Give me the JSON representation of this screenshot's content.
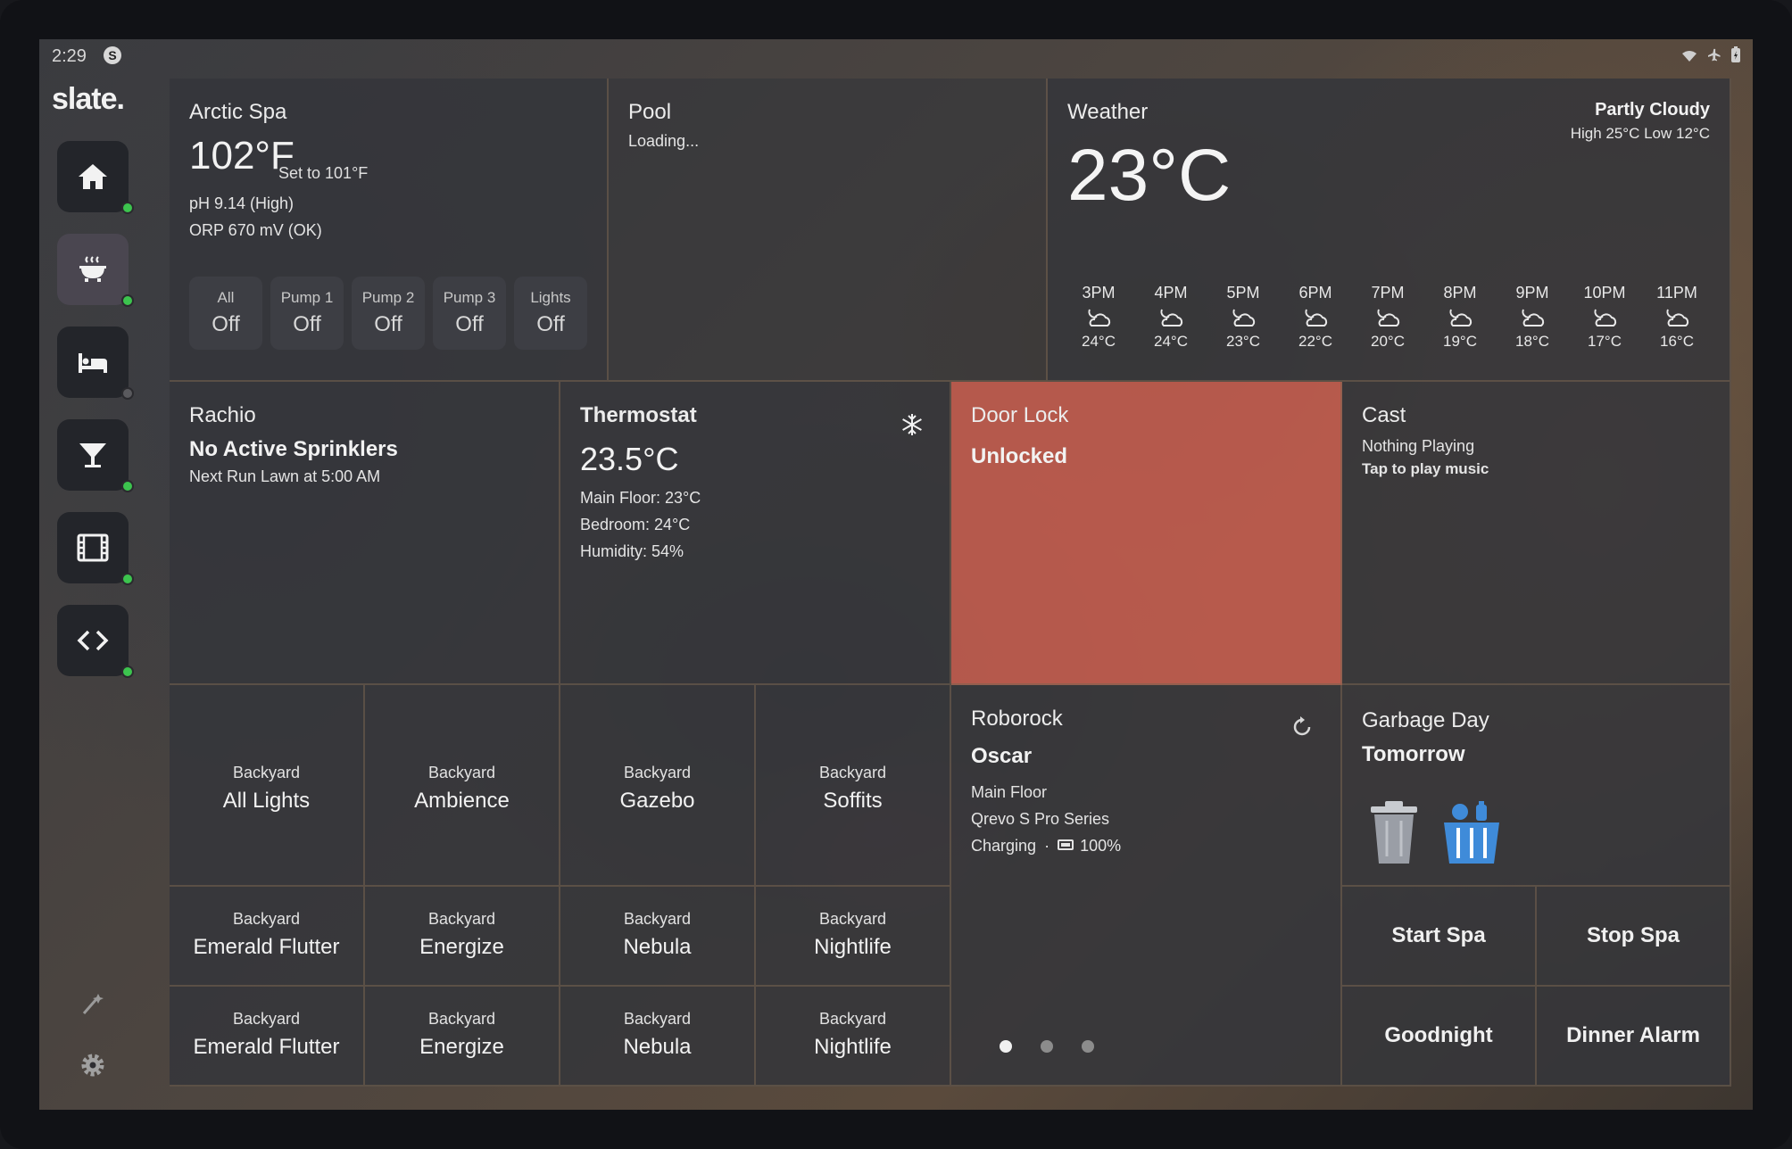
{
  "status": {
    "time": "2:29",
    "badge": "S"
  },
  "app": {
    "logo": "slate."
  },
  "nav": {
    "items": [
      {
        "icon": "home-icon",
        "active": false,
        "online": true
      },
      {
        "icon": "hot-tub-icon",
        "active": true,
        "online": true
      },
      {
        "icon": "bed-icon",
        "active": false,
        "online": false
      },
      {
        "icon": "cocktail-icon",
        "active": false,
        "online": true
      },
      {
        "icon": "film-icon",
        "active": false,
        "online": true
      },
      {
        "icon": "code-icon",
        "active": false,
        "online": true
      }
    ],
    "bottom": [
      "wand-icon",
      "gear-icon"
    ]
  },
  "spa": {
    "title": "Arctic Spa",
    "temp": "102°F",
    "setpoint": "Set to 101°F",
    "ph": "pH 9.14 (High)",
    "orp": "ORP 670 mV (OK)",
    "buttons": [
      {
        "label": "All",
        "value": "Off"
      },
      {
        "label": "Pump 1",
        "value": "Off"
      },
      {
        "label": "Pump 2",
        "value": "Off"
      },
      {
        "label": "Pump 3",
        "value": "Off"
      },
      {
        "label": "Lights",
        "value": "Off"
      }
    ]
  },
  "pool": {
    "title": "Pool",
    "status": "Loading..."
  },
  "weather": {
    "title": "Weather",
    "temp": "23°C",
    "condition": "Partly Cloudy",
    "highlow": "High 25°C  Low 12°C",
    "hourly": [
      {
        "hour": "3PM",
        "temp": "24°C",
        "icon": "partly-cloudy-night-icon"
      },
      {
        "hour": "4PM",
        "temp": "24°C",
        "icon": "partly-cloudy-night-icon"
      },
      {
        "hour": "5PM",
        "temp": "23°C",
        "icon": "partly-cloudy-night-icon"
      },
      {
        "hour": "6PM",
        "temp": "22°C",
        "icon": "partly-cloudy-night-icon"
      },
      {
        "hour": "7PM",
        "temp": "20°C",
        "icon": "partly-cloudy-night-icon"
      },
      {
        "hour": "8PM",
        "temp": "19°C",
        "icon": "partly-cloudy-night-icon"
      },
      {
        "hour": "9PM",
        "temp": "18°C",
        "icon": "partly-cloudy-night-icon"
      },
      {
        "hour": "10PM",
        "temp": "17°C",
        "icon": "partly-cloudy-night-icon"
      },
      {
        "hour": "11PM",
        "temp": "16°C",
        "icon": "partly-cloudy-night-icon"
      }
    ]
  },
  "rachio": {
    "title": "Rachio",
    "status": "No Active Sprinklers",
    "next": "Next Run Lawn at 5:00 AM"
  },
  "thermostat": {
    "title": "Thermostat",
    "temp": "23.5°C",
    "main": "Main Floor: 23°C",
    "bedroom": "Bedroom: 24°C",
    "humidity": "Humidity: 54%",
    "mode_icon": "snowflake-icon"
  },
  "doorlock": {
    "title": "Door Lock",
    "state": "Unlocked",
    "color": "#c45c4e"
  },
  "cast": {
    "title": "Cast",
    "status": "Nothing Playing",
    "hint": "Tap to play music"
  },
  "lights": {
    "row1": [
      {
        "room": "Backyard",
        "name": "All Lights"
      },
      {
        "room": "Backyard",
        "name": "Ambience"
      },
      {
        "room": "Backyard",
        "name": "Gazebo"
      },
      {
        "room": "Backyard",
        "name": "Soffits"
      }
    ],
    "row2": [
      {
        "room": "Backyard",
        "name": "Emerald Flutter"
      },
      {
        "room": "Backyard",
        "name": "Energize"
      },
      {
        "room": "Backyard",
        "name": "Nebula"
      },
      {
        "room": "Backyard",
        "name": "Nightlife"
      }
    ],
    "row3": [
      {
        "room": "Backyard",
        "name": "Emerald Flutter"
      },
      {
        "room": "Backyard",
        "name": "Energize"
      },
      {
        "room": "Backyard",
        "name": "Nebula"
      },
      {
        "room": "Backyard",
        "name": "Nightlife"
      }
    ]
  },
  "roborock": {
    "title": "Roborock",
    "name": "Oscar",
    "floor": "Main Floor",
    "model": "Qrevo S Pro Series",
    "state": "Charging",
    "separator": "·",
    "battery": "100%"
  },
  "garbage": {
    "title": "Garbage Day",
    "when": "Tomorrow",
    "bins": [
      "garbage-bin-icon",
      "recycling-bin-icon"
    ],
    "recycle_color": "#3f8bd9"
  },
  "actions": {
    "start_spa": "Start Spa",
    "stop_spa": "Stop Spa",
    "goodnight": "Goodnight",
    "dinner_alarm": "Dinner Alarm"
  },
  "pager": {
    "pages": 3,
    "current": 1
  }
}
